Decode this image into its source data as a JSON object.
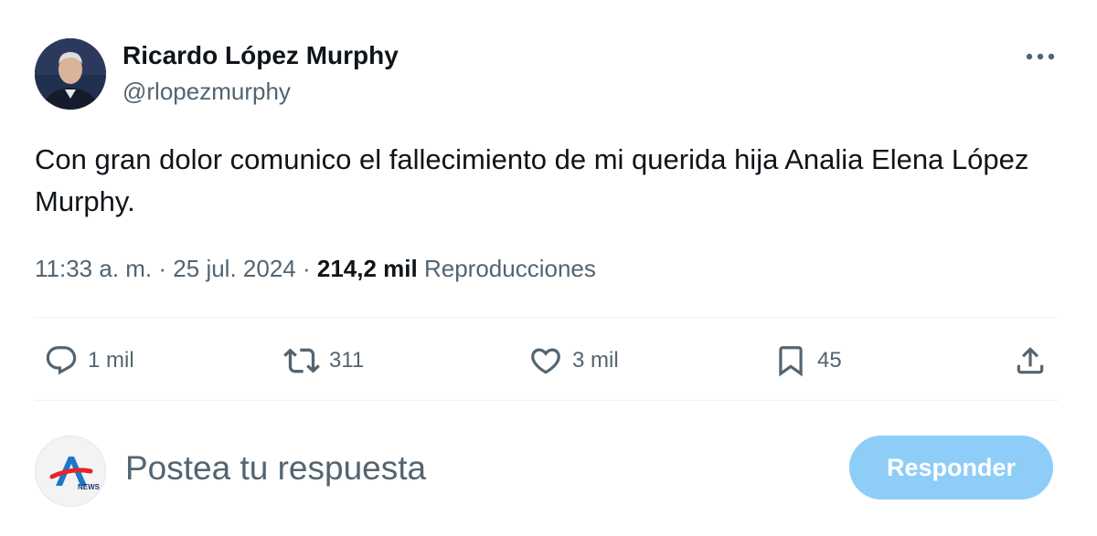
{
  "author": {
    "name": "Ricardo López Murphy",
    "handle": "@rlopezmurphy"
  },
  "tweet": {
    "text": "Con gran dolor comunico el fallecimiento de mi querida hija Analia Elena López Murphy."
  },
  "meta": {
    "time": "11:33 a. m.",
    "separator": "·",
    "date": "25 jul. 2024",
    "views_count": "214,2 mil",
    "views_label": "Reproducciones"
  },
  "actions": {
    "replies": "1 mil",
    "retweets": "311",
    "likes": "3 mil",
    "bookmarks": "45"
  },
  "reply_box": {
    "placeholder": "Postea tu respuesta",
    "button_label": "Responder",
    "avatar_brand": "NEWS"
  },
  "colors": {
    "text_primary": "#0f1419",
    "text_secondary": "#536471",
    "button_disabled": "#8ecdf8",
    "divider": "#eff3f4"
  },
  "icons": {
    "more": "more-horizontal-icon",
    "reply": "reply-bubble-icon",
    "retweet": "retweet-icon",
    "like": "heart-icon",
    "bookmark": "bookmark-icon",
    "share": "share-upload-icon"
  }
}
